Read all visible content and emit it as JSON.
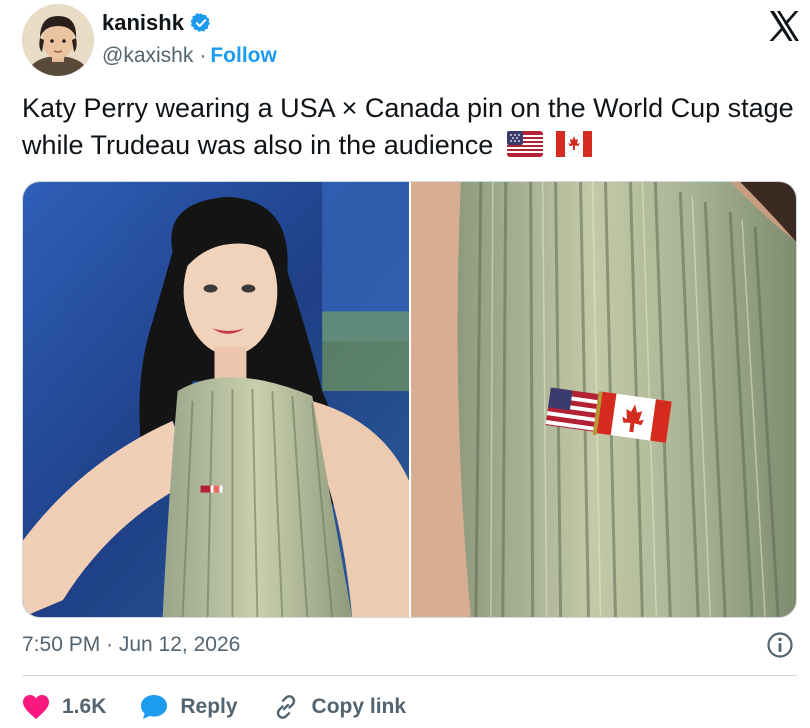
{
  "author": {
    "display_name": "kanishk",
    "handle": "@kaxishk",
    "separator": "·",
    "follow_label": "Follow"
  },
  "tweet": {
    "text": "Katy Perry wearing a USA × Canada pin on the World Cup stage while Trudeau was also in the audience",
    "flags": [
      "us-flag-emoji",
      "canada-flag-emoji"
    ]
  },
  "meta": {
    "timestamp": "7:50 PM · Jun 12, 2026"
  },
  "actions": {
    "like_count": "1.6K",
    "reply_label": "Reply",
    "copy_link_label": "Copy link"
  },
  "colors": {
    "accent": "#1d9bf0",
    "like": "#f91880",
    "text": "#0f1419",
    "muted": "#536471"
  },
  "icons": {
    "verified": "verified-badge-icon",
    "platform": "x-logo-icon",
    "info": "info-icon",
    "like": "heart-icon",
    "reply": "speech-bubble-icon",
    "copy_link": "link-icon"
  }
}
